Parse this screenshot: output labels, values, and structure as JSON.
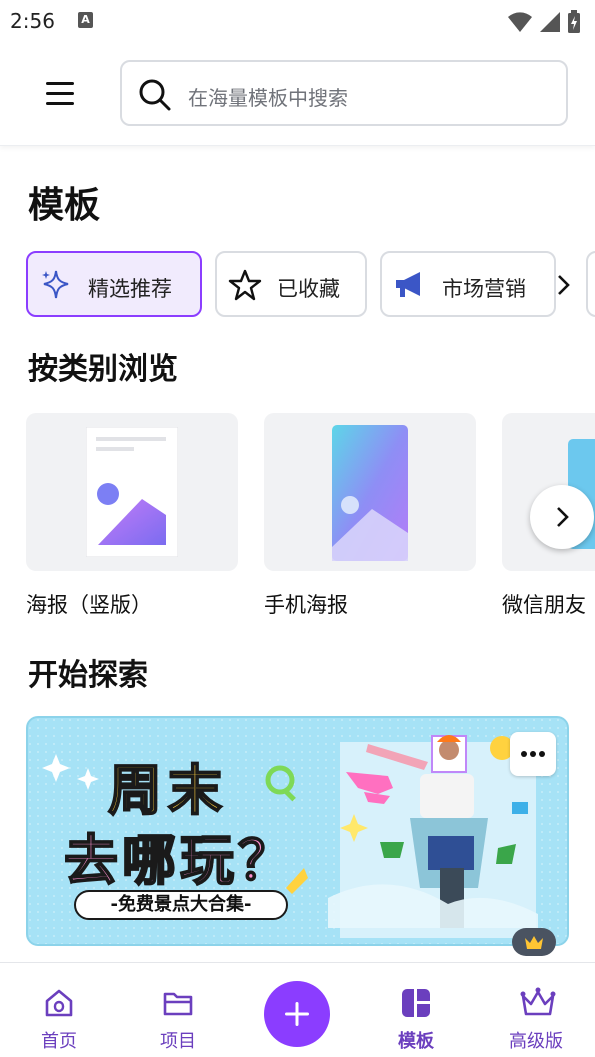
{
  "status_bar": {
    "time": "2:56",
    "a_badge": "A"
  },
  "search": {
    "placeholder": "在海量模板中搜索"
  },
  "page_title": "模板",
  "chips": [
    {
      "label": "精选推荐",
      "icon": "sparkle-icon",
      "selected": true
    },
    {
      "label": "已收藏",
      "icon": "star-icon",
      "selected": false
    },
    {
      "label": "市场营销",
      "icon": "megaphone-icon",
      "selected": false
    }
  ],
  "browse_title": "按类别浏览",
  "categories": [
    {
      "label": "海报（竖版）"
    },
    {
      "label": "手机海报"
    },
    {
      "label": "微信朋友"
    }
  ],
  "explore_title": "开始探索",
  "banner": {
    "line1": "周末",
    "line2": "去哪玩？",
    "tagline": "-免费景点大合集-"
  },
  "nav": [
    {
      "label": "首页",
      "icon": "home-icon"
    },
    {
      "label": "项目",
      "icon": "folder-icon"
    },
    {
      "label": "模板",
      "icon": "template-icon",
      "active": true
    },
    {
      "label": "高级版",
      "icon": "crown-icon"
    }
  ],
  "colors": {
    "accent": "#8b3dff",
    "nav_label": "#6b3fbe",
    "chip_selected_bg": "#f1ebfd"
  }
}
